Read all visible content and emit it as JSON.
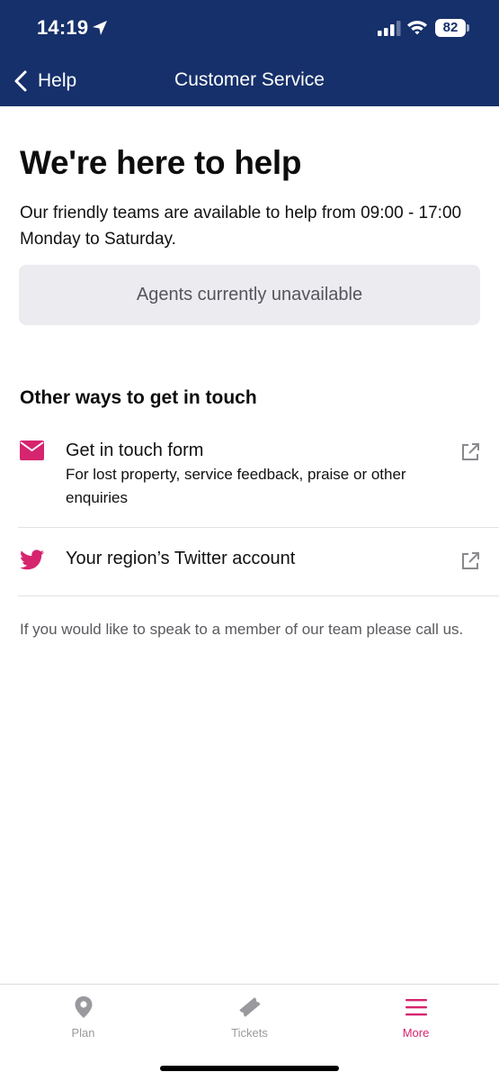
{
  "status_bar": {
    "time": "14:19",
    "battery": "82"
  },
  "nav": {
    "back_label": "Help",
    "title": "Customer Service"
  },
  "main": {
    "heading": "We're here to help",
    "intro": "Our friendly teams are available to help from 09:00 - 17:00 Monday to Saturday.",
    "agents_button": "Agents currently unavailable",
    "other_ways_heading": "Other ways to get in touch",
    "contact_items": [
      {
        "icon": "envelope-icon",
        "title": "Get in touch form",
        "subtitle": "For lost property, service feedback, praise or other enquiries"
      },
      {
        "icon": "twitter-icon",
        "title": "Your region’s Twitter account"
      }
    ],
    "footnote": "If you would like to speak to a member of our team please call us."
  },
  "tab_bar": {
    "tabs": [
      {
        "label": "Plan",
        "icon": "location-pin-icon",
        "active": false
      },
      {
        "label": "Tickets",
        "icon": "ticket-icon",
        "active": false
      },
      {
        "label": "More",
        "icon": "menu-icon",
        "active": true
      }
    ]
  },
  "colors": {
    "header_bg": "#16306b",
    "accent": "#d6246e",
    "inactive_tab": "#9a9a9e",
    "agents_bg": "#ececf0"
  }
}
